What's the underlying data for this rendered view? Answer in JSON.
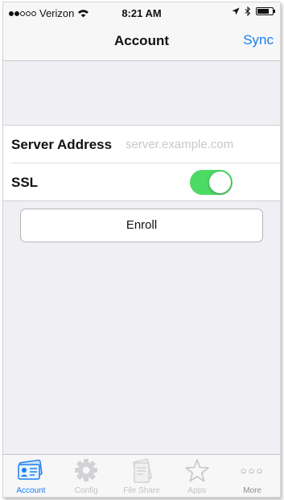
{
  "status_bar": {
    "carrier": "Verizon",
    "time": "8:21 AM",
    "signal_filled": 2,
    "signal_total": 5,
    "battery_level": 0.75
  },
  "nav": {
    "title": "Account",
    "sync_label": "Sync"
  },
  "settings": {
    "server_address_label": "Server Address",
    "server_address_value": "",
    "server_address_placeholder": "server.example.com",
    "ssl_label": "SSL",
    "ssl_enabled": true
  },
  "enroll_label": "Enroll",
  "tabs": [
    {
      "label": "Account",
      "icon": "account-card-icon",
      "active": true
    },
    {
      "label": "Config",
      "icon": "gear-icon",
      "active": false
    },
    {
      "label": "File Share",
      "icon": "file-share-icon",
      "active": false
    },
    {
      "label": "Apps",
      "icon": "star-icon",
      "active": false
    },
    {
      "label": "More",
      "icon": "more-dots-icon",
      "active": false
    }
  ],
  "colors": {
    "accent": "#1a7ef0",
    "toggle_on": "#4cd964",
    "background": "#efeff4"
  }
}
